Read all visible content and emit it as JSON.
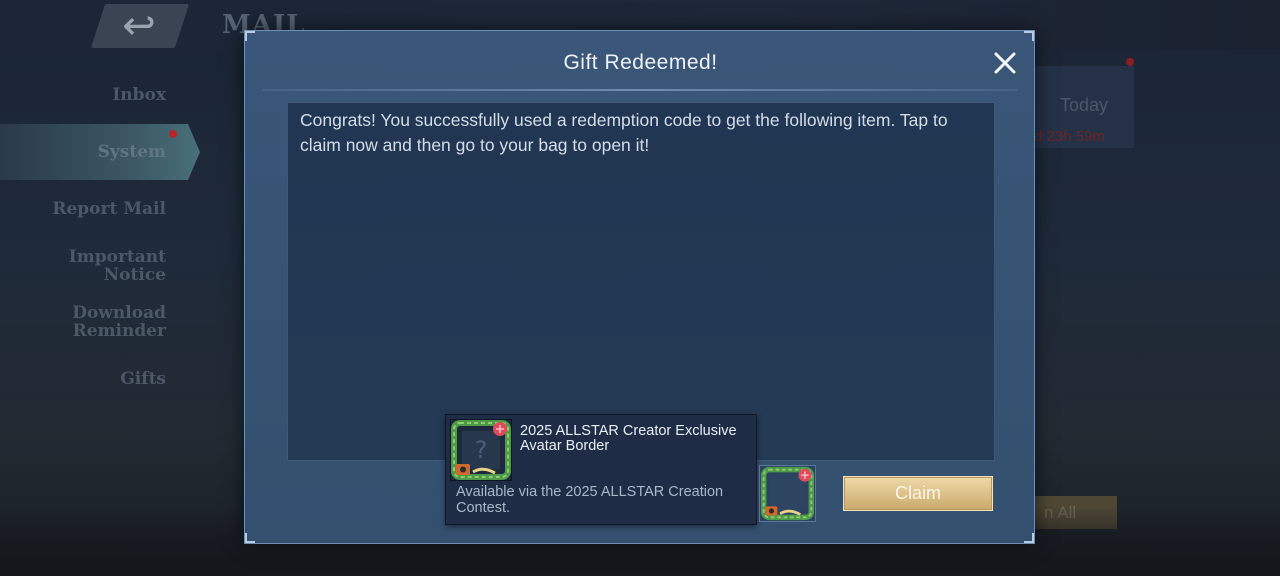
{
  "background": {
    "screen_title": "MAIL",
    "back_icon": "back-arrow-icon",
    "sidebar": [
      {
        "id": "inbox",
        "label": "Inbox",
        "active": false
      },
      {
        "id": "system",
        "label": "System",
        "active": true,
        "notification": true
      },
      {
        "id": "report",
        "label": "Report Mail",
        "active": false
      },
      {
        "id": "important",
        "label": "Important Notice",
        "active": false
      },
      {
        "id": "download",
        "label": "Download Reminder",
        "active": false
      },
      {
        "id": "gifts",
        "label": "Gifts",
        "active": false
      }
    ],
    "list_date": "Today",
    "list_timer": "d 23h 59m",
    "claim_all_fragment": "n All"
  },
  "dialog": {
    "title": "Gift Redeemed!",
    "close_icon": "close-icon",
    "message": "Congrats! You successfully used a redemption code to get the following item. Tap to claim now and then go to your bag to open it!",
    "item": {
      "name": "2025 ALLSTAR Creator Exclusive Avatar Border",
      "description": "Available via the 2025 ALLSTAR Creation Contest.",
      "icon": "avatar-border-icon"
    },
    "claim_label": "Claim"
  },
  "colors": {
    "dialog_bg": "#3a5678",
    "panel_bg": "#213652",
    "claim_gold": "#d9bd83",
    "notification_red": "#b8242a"
  }
}
